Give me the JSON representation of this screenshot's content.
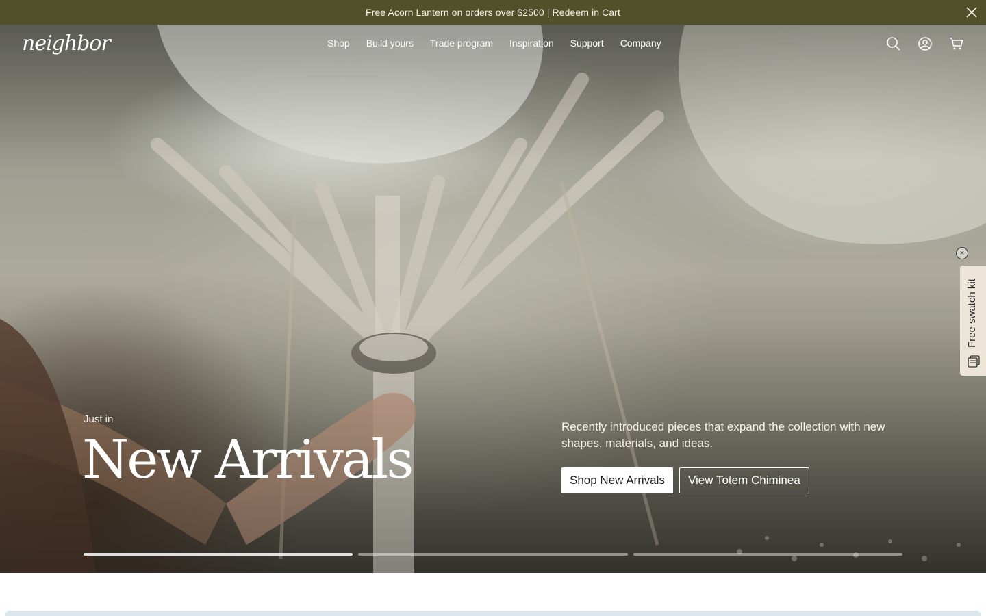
{
  "announcement": {
    "text": "Free Acorn Lantern on orders over $2500 | Redeem in Cart",
    "close_icon": "close-icon"
  },
  "header": {
    "logo": "neighbor",
    "nav": [
      "Shop",
      "Build yours",
      "Trade program",
      "Inspiration",
      "Support",
      "Company"
    ],
    "icons": [
      "search-icon",
      "account-icon",
      "cart-icon"
    ]
  },
  "hero": {
    "eyebrow": "Just in",
    "title": "New Arrivals",
    "description": "Recently introduced pieces that expand the collection with new shapes, materials, and ideas.",
    "primary_button": "Shop New Arrivals",
    "secondary_button": "View Totem Chiminea",
    "slides": 3,
    "active_slide": 1
  },
  "swatch": {
    "label": "Free swatch kit",
    "icon": "swatch-icon",
    "close": "×"
  },
  "colors": {
    "announcement_bg": "#50512b",
    "swatch_bg": "#ece5d8"
  }
}
